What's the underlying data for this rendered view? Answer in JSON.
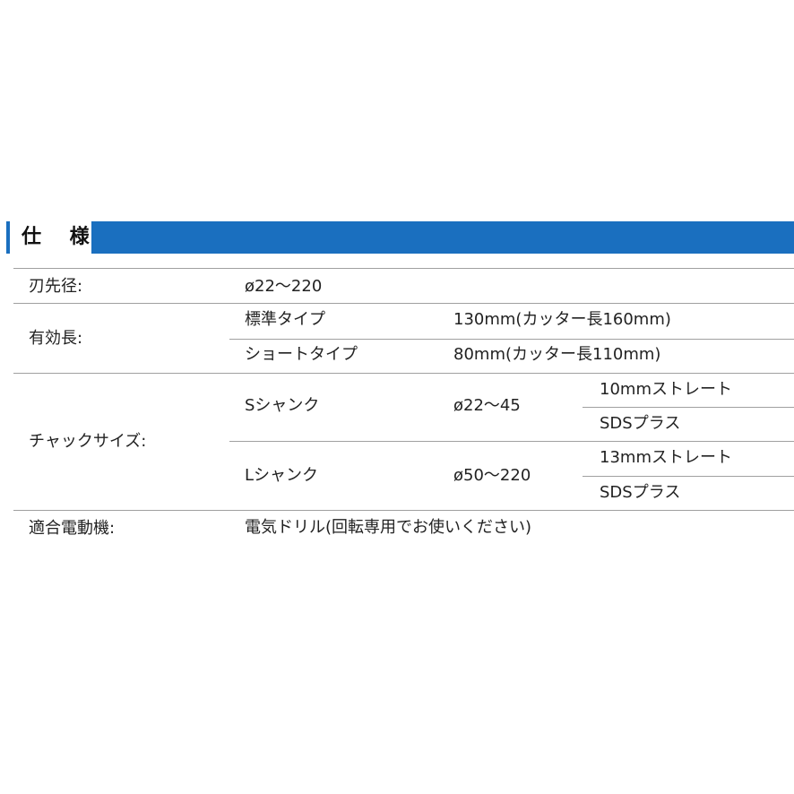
{
  "section": {
    "title": "仕 様"
  },
  "spec": {
    "blade_diameter": {
      "label": "刃先径:",
      "value": "ø22～220"
    },
    "effective_length": {
      "label": "有効長:",
      "rows": [
        {
          "type": "標準タイプ",
          "value": "130mm(カッター長160mm)"
        },
        {
          "type": "ショートタイプ",
          "value": "80mm(カッター長110mm)"
        }
      ]
    },
    "chuck_size": {
      "label": "チャックサイズ:",
      "groups": [
        {
          "shank": "Sシャンク",
          "range": "ø22～45",
          "options": [
            "10mmストレート",
            "SDSプラス"
          ]
        },
        {
          "shank": "Lシャンク",
          "range": "ø50～220",
          "options": [
            "13mmストレート",
            "SDSプラス"
          ]
        }
      ]
    },
    "compatible_tool": {
      "label": "適合電動機:",
      "value": "電気ドリル(回転専用でお使いください)"
    }
  }
}
